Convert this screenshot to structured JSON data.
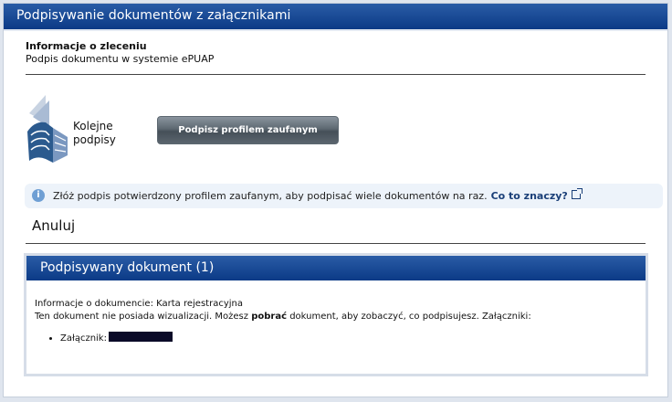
{
  "window": {
    "title": "Podpisywanie dokumentów z załącznikami"
  },
  "order": {
    "heading": "Informacje o zleceniu",
    "description": "Podpis dokumentu w systemie ePUAP"
  },
  "logo": {
    "label_line1": "Kolejne",
    "label_line2": "podpisy"
  },
  "sign_button": {
    "label": "Podpisz profilem zaufanym"
  },
  "info": {
    "text": "Złóż podpis potwierdzony profilem zaufanym, aby podpisać wiele dokumentów na raz.",
    "link": "Co to znaczy?"
  },
  "cancel": {
    "label": "Anuluj"
  },
  "document": {
    "header": "Podpisywany dokument (1)",
    "info_line": "Informacje o dokumencie: Karta rejestracyjna",
    "vis_part1": "Ten dokument nie posiada wizualizacji. Możesz",
    "vis_download": "pobrać",
    "vis_part2": "dokument, aby zobaczyć, co podpisujesz. Załączniki:",
    "attachment_label": "Załącznik:"
  },
  "colors": {
    "header_blue": "#0b3a86",
    "info_bg": "#edf3fa",
    "link": "#1a3f78"
  },
  "icons": [
    "info-icon",
    "external-link-icon",
    "signatures-logo"
  ]
}
